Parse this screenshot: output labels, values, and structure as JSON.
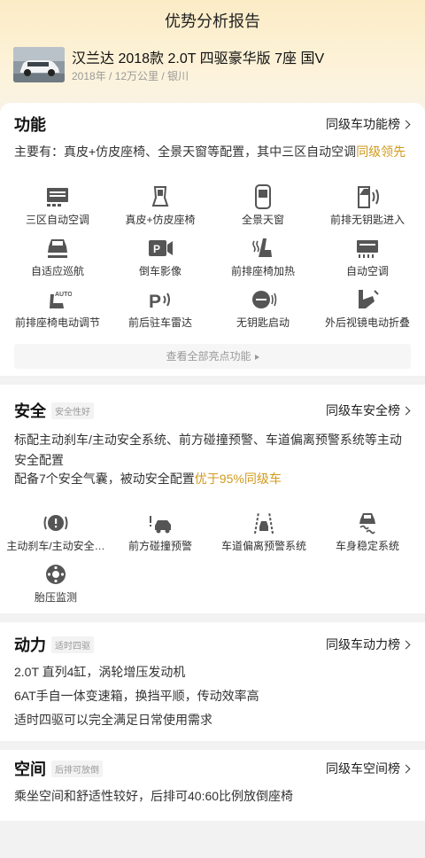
{
  "header": {
    "title": "优势分析报告"
  },
  "car": {
    "name": "汉兰达 2018款 2.0T 四驱豪华版 7座 国V",
    "meta": "2018年 / 12万公里 / 银川"
  },
  "function": {
    "title": "功能",
    "link": "同级车功能榜",
    "summary_prefix": "主要有：真皮+仿皮座椅、全景天窗等配置，其中三区自动空调",
    "summary_highlight": "同级领先",
    "items": [
      {
        "label": "三区自动空调",
        "icon": "ac-zone-icon"
      },
      {
        "label": "真皮+仿皮座椅",
        "icon": "seat-icon"
      },
      {
        "label": "全景天窗",
        "icon": "sunroof-icon"
      },
      {
        "label": "前排无钥匙进入",
        "icon": "keyless-entry-icon"
      },
      {
        "label": "自适应巡航",
        "icon": "adaptive-cruise-icon"
      },
      {
        "label": "倒车影像",
        "icon": "rear-camera-icon"
      },
      {
        "label": "前排座椅加热",
        "icon": "seat-heating-icon"
      },
      {
        "label": "自动空调",
        "icon": "auto-ac-icon"
      },
      {
        "label": "前排座椅电动调节",
        "icon": "power-seat-icon"
      },
      {
        "label": "前后驻车雷达",
        "icon": "parking-radar-icon"
      },
      {
        "label": "无钥匙启动",
        "icon": "keyless-start-icon"
      },
      {
        "label": "外后视镜电动折叠",
        "icon": "mirror-fold-icon"
      }
    ],
    "more": "查看全部亮点功能"
  },
  "safety": {
    "title": "安全",
    "tag": "安全性好",
    "link": "同级车安全榜",
    "desc1": "标配主动刹车/主动安全系统、前方碰撞预警、车道偏离预警系统等主动安全配置",
    "desc2_prefix": "配备7个安全气囊，被动安全配置",
    "desc2_highlight": "优于95%同级车",
    "items": [
      {
        "label": "主动刹车/主动安全…",
        "icon": "active-brake-icon"
      },
      {
        "label": "前方碰撞预警",
        "icon": "collision-warning-icon"
      },
      {
        "label": "车道偏离预警系统",
        "icon": "lane-departure-icon"
      },
      {
        "label": "车身稳定系统",
        "icon": "stability-control-icon"
      },
      {
        "label": "胎压监测",
        "icon": "tire-pressure-icon"
      }
    ]
  },
  "power": {
    "title": "动力",
    "tag": "适时四驱",
    "link": "同级车动力榜",
    "lines": [
      "2.0T 直列4缸，涡轮增压发动机",
      "6AT手自一体变速箱，换挡平顺，传动效率高",
      "适时四驱可以完全满足日常使用需求"
    ]
  },
  "space": {
    "title": "空间",
    "tag": "后排可放倒",
    "link": "同级车空间榜",
    "line": "乘坐空间和舒适性较好，后排可40:60比例放倒座椅"
  },
  "colors": {
    "accent": "#d19a1c",
    "hero_top": "#fcecc6",
    "icon": "#555555"
  }
}
